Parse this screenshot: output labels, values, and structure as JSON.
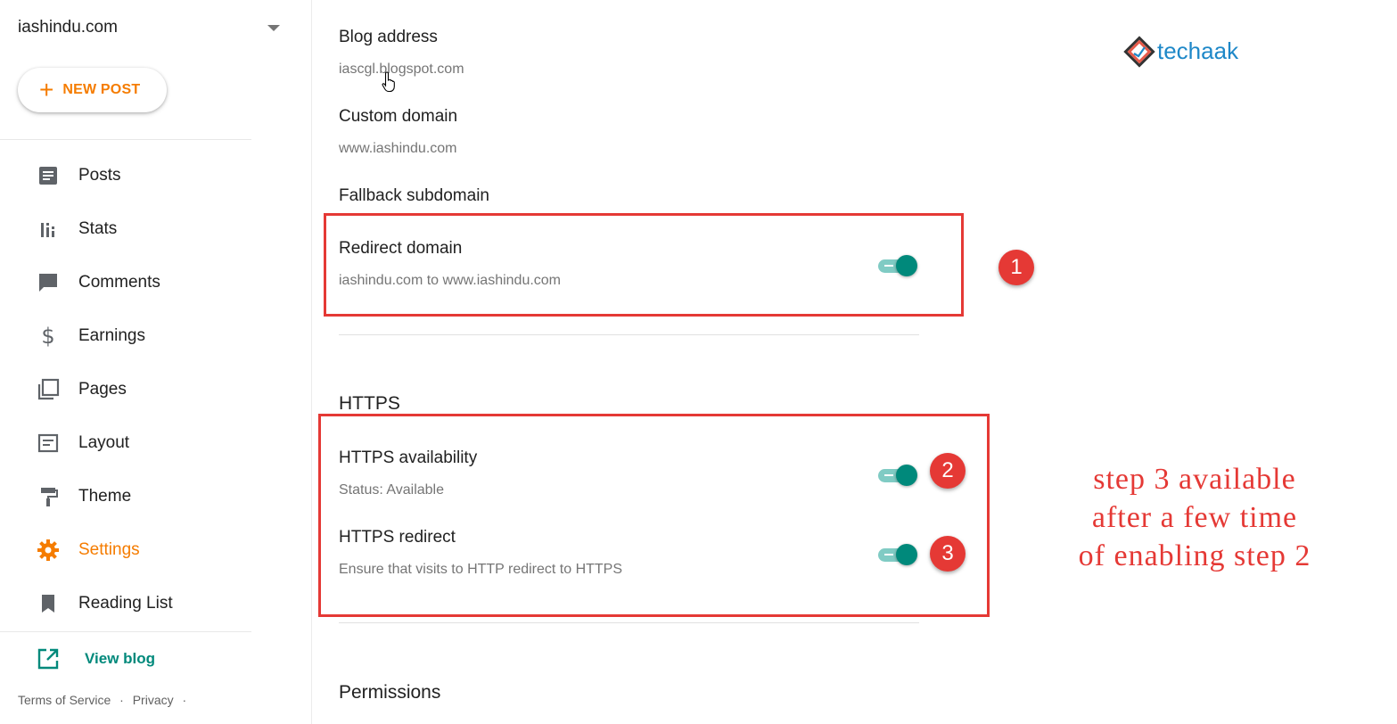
{
  "sidebar": {
    "blog_name": "iashindu.com",
    "new_post_label": "NEW POST",
    "items": [
      {
        "label": "Posts",
        "icon": "posts-icon"
      },
      {
        "label": "Stats",
        "icon": "stats-icon"
      },
      {
        "label": "Comments",
        "icon": "comments-icon"
      },
      {
        "label": "Earnings",
        "icon": "dollar-icon"
      },
      {
        "label": "Pages",
        "icon": "pages-icon"
      },
      {
        "label": "Layout",
        "icon": "layout-icon"
      },
      {
        "label": "Theme",
        "icon": "paint-roller-icon"
      },
      {
        "label": "Settings",
        "icon": "gear-icon",
        "active": true
      },
      {
        "label": "Reading List",
        "icon": "bookmark-icon"
      }
    ],
    "view_blog_label": "View blog",
    "footer": {
      "terms": "Terms of Service",
      "privacy": "Privacy",
      "dot": "·"
    }
  },
  "main": {
    "blog_address": {
      "label": "Blog address",
      "value": "iascgl.blogspot.com"
    },
    "custom_domain": {
      "label": "Custom domain",
      "value": "www.iashindu.com"
    },
    "fallback_subdomain": {
      "label": "Fallback subdomain"
    },
    "redirect_domain": {
      "label": "Redirect domain",
      "value": "iashindu.com to www.iashindu.com",
      "enabled": true
    },
    "https": {
      "heading": "HTTPS",
      "availability": {
        "label": "HTTPS availability",
        "value": "Status: Available",
        "enabled": true
      },
      "redirect": {
        "label": "HTTPS redirect",
        "value": "Ensure that visits to HTTP redirect to HTTPS",
        "enabled": true
      }
    },
    "permissions_heading": "Permissions"
  },
  "annotations": {
    "badges": [
      "1",
      "2",
      "3"
    ],
    "note_lines": [
      "step 3 available",
      "after a few time",
      "of enabling step 2"
    ]
  },
  "logo": {
    "text": "techaak"
  },
  "colors": {
    "accent_orange": "#f57c00",
    "teal": "#00897b",
    "annotation_red": "#e53935",
    "logo_blue": "#1e88c8"
  }
}
